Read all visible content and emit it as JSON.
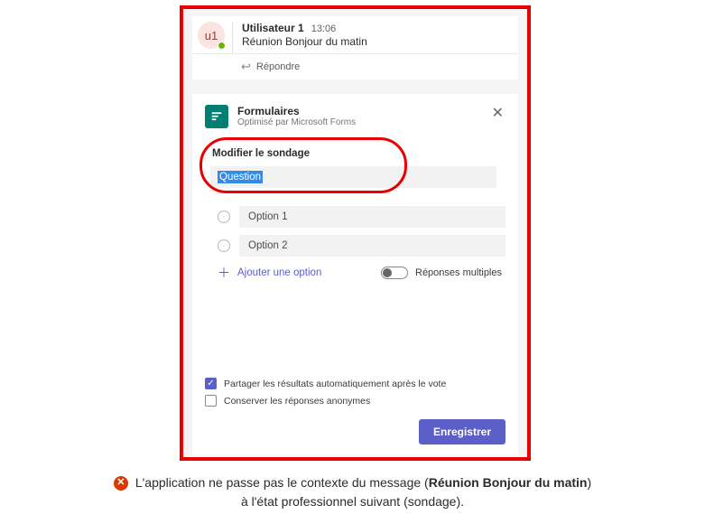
{
  "chat": {
    "avatar_label": "u1",
    "author": "Utilisateur 1",
    "time": "13:06",
    "message": "Réunion Bonjour du matin",
    "reply_label": "Répondre"
  },
  "forms": {
    "title": "Formulaires",
    "subtitle": "Optimisé par Microsoft Forms",
    "section_label": "Modifier le sondage",
    "question_placeholder": "Question",
    "options": [
      "Option 1",
      "Option 2"
    ],
    "add_option_label": "Ajouter une option",
    "multi_label": "Réponses multiples",
    "share_results_label": "Partager les résultats automatiquement après le vote",
    "anon_label": "Conserver les réponses anonymes",
    "save_label": "Enregistrer"
  },
  "caption": {
    "part1": "L'application ne passe pas le contexte du message (",
    "bold": "Réunion Bonjour du matin",
    "part2": ")",
    "line2": "à l'état professionnel suivant (sondage)."
  }
}
